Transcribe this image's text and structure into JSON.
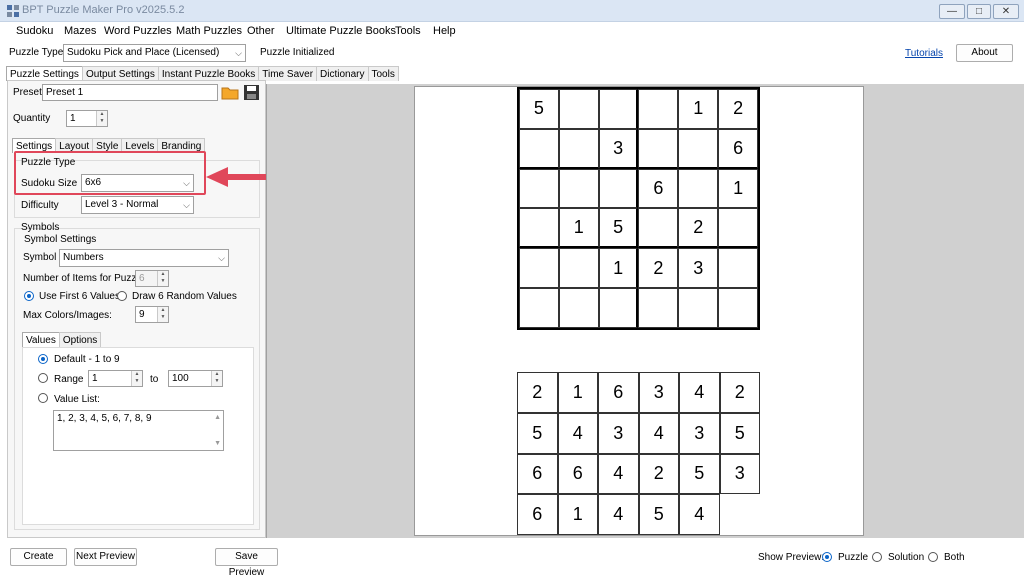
{
  "window": {
    "title": "BPT Puzzle Maker Pro v2025.5.2",
    "minimize": "—",
    "maximize": "□",
    "close": "✕"
  },
  "menu": [
    "Sudoku",
    "Mazes",
    "Word Puzzles",
    "Math Puzzles",
    "Other",
    "Ultimate Puzzle Books",
    "Tools",
    "Help"
  ],
  "toolbar": {
    "puzzle_type_label": "Puzzle Type",
    "puzzle_type_value": "Sudoku Pick and Place (Licensed)",
    "status": "Puzzle Initialized",
    "tutorials": "Tutorials",
    "about": "About"
  },
  "main_tabs": [
    "Puzzle Settings",
    "Output Settings",
    "Instant Puzzle Books",
    "Time Saver",
    "Dictionary",
    "Tools"
  ],
  "preset": {
    "label": "Preset",
    "value": "Preset 1"
  },
  "quantity": {
    "label": "Quantity",
    "value": "1"
  },
  "sub_tabs": [
    "Settings",
    "Layout",
    "Style",
    "Levels",
    "Branding"
  ],
  "puzzle_type_group": {
    "title": "Puzzle Type",
    "size_label": "Sudoku Size",
    "size_value": "6x6",
    "difficulty_label": "Difficulty",
    "difficulty_value": "Level 3 - Normal"
  },
  "symbols": {
    "title": "Symbols",
    "settings_title": "Symbol Settings",
    "symbol_label": "Symbol",
    "symbol_value": "Numbers",
    "items_label": "Number of Items for Puzzle:",
    "items_value": "6",
    "use_first": "Use First 6 Values",
    "draw_random": "Draw 6 Random Values",
    "max_colors_label": "Max Colors/Images:",
    "max_colors_value": "9"
  },
  "values_tabs": [
    "Values",
    "Options"
  ],
  "values": {
    "default_label": "Default - 1 to 9",
    "range_label": "Range",
    "range_from": "1",
    "to_label": "to",
    "range_to": "100",
    "list_label": "Value List:",
    "list_value": "1, 2, 3, 4, 5, 6, 7, 8, 9"
  },
  "puzzle_grid": [
    [
      "5",
      "",
      "",
      "",
      "1",
      "2"
    ],
    [
      "",
      "",
      "3",
      "",
      "",
      "6"
    ],
    [
      "",
      "",
      "",
      "6",
      "",
      "1"
    ],
    [
      "",
      "1",
      "5",
      "",
      "2",
      ""
    ],
    [
      "",
      "",
      "1",
      "2",
      "3",
      ""
    ],
    [
      "",
      "",
      "",
      "",
      "",
      ""
    ]
  ],
  "pick_pieces": [
    [
      "2",
      "1",
      "6",
      "3",
      "4",
      "2"
    ],
    [
      "5",
      "4",
      "3",
      "4",
      "3",
      "5"
    ],
    [
      "6",
      "6",
      "4",
      "2",
      "5",
      "3"
    ],
    [
      "6",
      "1",
      "4",
      "5",
      "4"
    ]
  ],
  "bottom": {
    "create": "Create",
    "next_preview": "Next Preview",
    "save_preview": "Save Preview",
    "show_preview_label": "Show Preview:",
    "opt_puzzle": "Puzzle",
    "opt_solution": "Solution",
    "opt_both": "Both"
  },
  "colors": {
    "highlight": "#e0475a",
    "accent": "#0a64c8"
  }
}
